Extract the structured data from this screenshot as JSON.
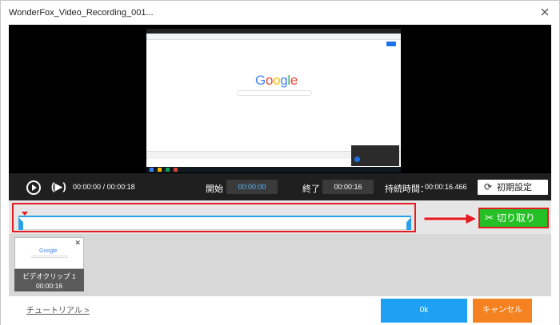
{
  "window": {
    "title": "WonderFox_Video_Recording_001..."
  },
  "preview": {
    "google_logo": [
      "G",
      "o",
      "o",
      "g",
      "l",
      "e"
    ],
    "google_colors": [
      "#4285f4",
      "#ea4335",
      "#fbbc05",
      "#4285f4",
      "#34a853",
      "#ea4335"
    ]
  },
  "controls": {
    "current_time": "00:00:00",
    "separator": "/",
    "total_time": "00:00:18",
    "start_label": "開始",
    "start_value": "00:00:00",
    "end_label": "終了",
    "end_value": "00:00:16",
    "duration_label": "持続時間：",
    "duration_value": "00:00:16.466",
    "reset_label": "初期設定",
    "reset_icon": "refresh-icon"
  },
  "trim": {
    "cut_label": "切り取り",
    "cut_icon": "scissors-icon",
    "accent": "#2aa0e8",
    "highlight": "#e51c23",
    "cut_color": "#25c025"
  },
  "clips": [
    {
      "name": "ビデオクリップ 1",
      "time": "00:00:16",
      "thumb_text": "Google"
    }
  ],
  "footer": {
    "tutorial": "チュートリアル >",
    "ok": "0k",
    "cancel": "キャンセル",
    "ok_color": "#1ea1f2",
    "cancel_color": "#f58220"
  }
}
